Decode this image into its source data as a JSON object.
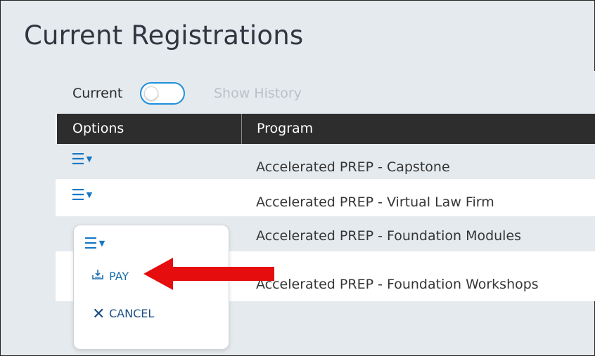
{
  "page": {
    "title": "Current Registrations"
  },
  "toolbar": {
    "toggle_label": "Current",
    "toggle_on": false,
    "history_label": "Show History"
  },
  "table": {
    "headers": [
      "Options",
      "Program"
    ],
    "rows": [
      {
        "program": "Accelerated PREP - Capstone"
      },
      {
        "program": "Accelerated PREP - Virtual Law Firm"
      },
      {
        "program": "Accelerated PREP - Foundation Modules"
      },
      {
        "program": "Accelerated PREP - Foundation Workshops"
      }
    ],
    "options_icon": "menu-dropdown-icon"
  },
  "options_menu": {
    "items": [
      {
        "label": "PAY",
        "icon": "pay-icon"
      },
      {
        "label": "CANCEL",
        "icon": "close-icon"
      }
    ]
  },
  "colors": {
    "accent": "#1e8fdc",
    "header_bg": "#2d2d2d",
    "annotation_arrow": "#e50d0d"
  }
}
